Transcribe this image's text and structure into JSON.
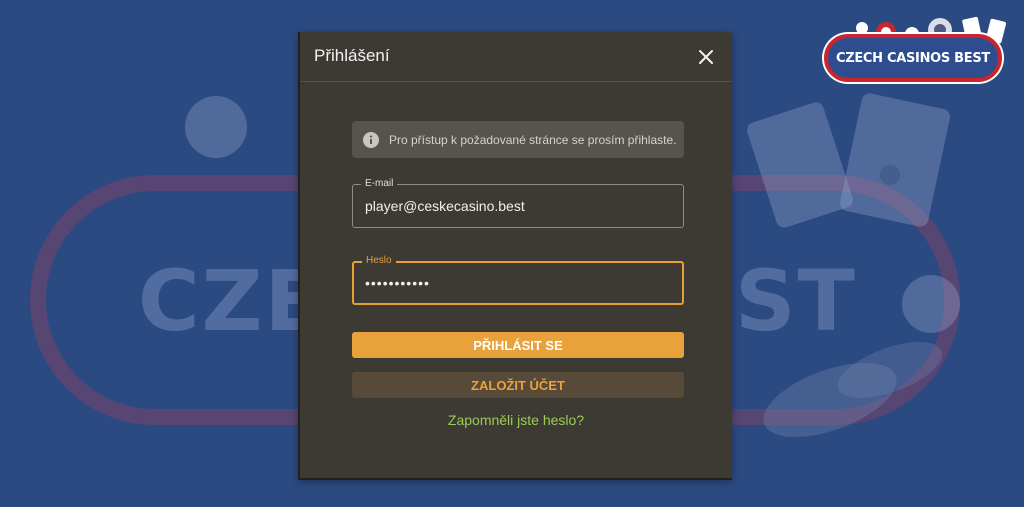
{
  "background": {
    "watermark_left": "CZEC",
    "watermark_right": "ST"
  },
  "logo": {
    "text": "CZECH CASINOS BEST"
  },
  "modal": {
    "title": "Přihlášení",
    "alert": {
      "icon": "info-icon",
      "text": "Pro přístup k požadované stránce se prosím přihlaste."
    },
    "email": {
      "label": "E-mail",
      "value": "player@ceskecasino.best"
    },
    "password": {
      "label": "Heslo",
      "value": "•••••••••••"
    },
    "login_button": "PŘIHLÁSIT SE",
    "register_button": "ZALOŽIT ÚČET",
    "forgot_link": "Zapomněli jste heslo?"
  },
  "colors": {
    "page_background": "#2c4a82",
    "modal_background": "#3d3a34",
    "accent": "#e9a23b",
    "link": "#9ccc55",
    "logo_border": "#c9252e"
  }
}
